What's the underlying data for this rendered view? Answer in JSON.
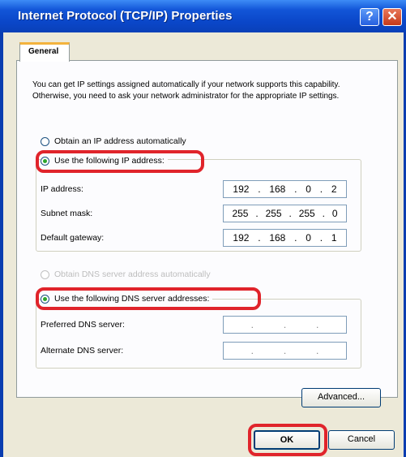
{
  "window": {
    "title": "Internet Protocol (TCP/IP) Properties",
    "help_label": "?",
    "close_label": "✕"
  },
  "tab": {
    "general": "General"
  },
  "description": "You can get IP settings assigned automatically if your network supports this capability. Otherwise, you need to ask your network administrator for the appropriate IP settings.",
  "ip": {
    "obtain_auto_label": "Obtain an IP address automatically",
    "use_following_label": "Use the following IP address:",
    "fields": [
      {
        "label": "IP address:",
        "octets": [
          "192",
          "168",
          "0",
          "2"
        ]
      },
      {
        "label": "Subnet mask:",
        "octets": [
          "255",
          "255",
          "255",
          "0"
        ]
      },
      {
        "label": "Default gateway:",
        "octets": [
          "192",
          "168",
          "0",
          "1"
        ]
      }
    ]
  },
  "dns": {
    "obtain_auto_label": "Obtain DNS server address automatically",
    "use_following_label": "Use the following DNS server addresses:",
    "preferred_label": "Preferred DNS server:",
    "alternate_label": "Alternate DNS server:"
  },
  "buttons": {
    "advanced": "Advanced...",
    "ok": "OK",
    "cancel": "Cancel"
  },
  "colors": {
    "titlebar": "#0a46c8",
    "highlight": "#e0242b",
    "radio_selected": "#2ca52c"
  }
}
